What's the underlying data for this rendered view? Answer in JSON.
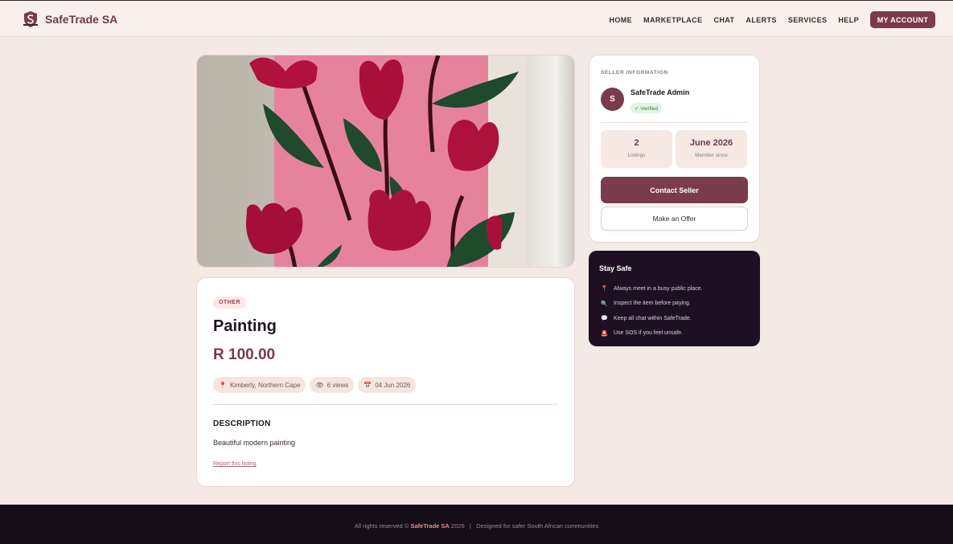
{
  "header": {
    "brand": "SafeTrade SA",
    "nav": [
      "HOME",
      "MARKETPLACE",
      "CHAT",
      "ALERTS",
      "SERVICES",
      "HELP"
    ],
    "account_button": "MY ACCOUNT"
  },
  "listing": {
    "category": "OTHER",
    "title": "Painting",
    "price": "R 100.00",
    "location": "Kimberly, Northern Cape",
    "views": "6 views",
    "date": "04 Jun 2026",
    "description_heading": "DESCRIPTION",
    "description": "Beautiful modern painting",
    "report_link": "Report this listing"
  },
  "seller": {
    "section_label": "SELLER INFORMATION",
    "avatar_initial": "S",
    "name": "SafeTrade Admin",
    "verified": "✓ Verified",
    "listings_value": "2",
    "listings_label": "Listings",
    "member_value": "June 2026",
    "member_label": "Member since",
    "contact_button": "Contact Seller",
    "offer_button": "Make an Offer"
  },
  "safety": {
    "title": "Stay Safe",
    "tips": [
      {
        "icon": "📍",
        "text": "Always meet in a busy public place."
      },
      {
        "icon": "🔍",
        "text": "Inspect the item before paying."
      },
      {
        "icon": "💬",
        "text": "Keep all chat within SafeTrade."
      },
      {
        "icon": "🚨",
        "text": "Use SOS if you feel unsafe."
      }
    ]
  },
  "footer": {
    "prefix": "All rights reserved © ",
    "brand": "SafeTrade SA",
    "suffix": " 2026   |   Designed for safer South African communities"
  },
  "colors": {
    "brand": "#7a3b4c",
    "background": "#f4e9e4",
    "dark": "#1e1022"
  }
}
